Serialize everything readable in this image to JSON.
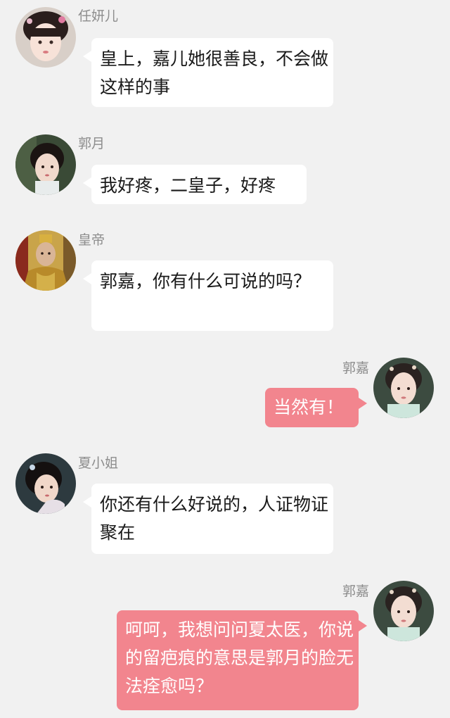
{
  "messages": [
    {
      "sender": "任妍儿",
      "side": "left",
      "text": "皇上，嘉儿她很善良，不会做这样的事",
      "avatar_icon": "avatar-ren-yan-er"
    },
    {
      "sender": "郭月",
      "side": "left",
      "text": "我好疼，二皇子，好疼",
      "avatar_icon": "avatar-guo-yue"
    },
    {
      "sender": "皇帝",
      "side": "left",
      "text": "郭嘉，你有什么可说的吗？",
      "avatar_icon": "avatar-emperor"
    },
    {
      "sender": "郭嘉",
      "side": "right",
      "text": "当然有！",
      "avatar_icon": "avatar-guo-jia"
    },
    {
      "sender": "夏小姐",
      "side": "left",
      "text": "你还有什么好说的，人证物证聚在",
      "avatar_icon": "avatar-xia-xiaojie"
    },
    {
      "sender": "郭嘉",
      "side": "right",
      "text": "呵呵，我想问问夏太医，你说的留疤痕的意思是郭月的脸无法痊愈吗？",
      "avatar_icon": "avatar-guo-jia"
    }
  ],
  "colors": {
    "background": "#f1f1f1",
    "incoming_bubble": "#ffffff",
    "outgoing_bubble": "#f2858e",
    "sender_name": "#8d8d8d"
  }
}
